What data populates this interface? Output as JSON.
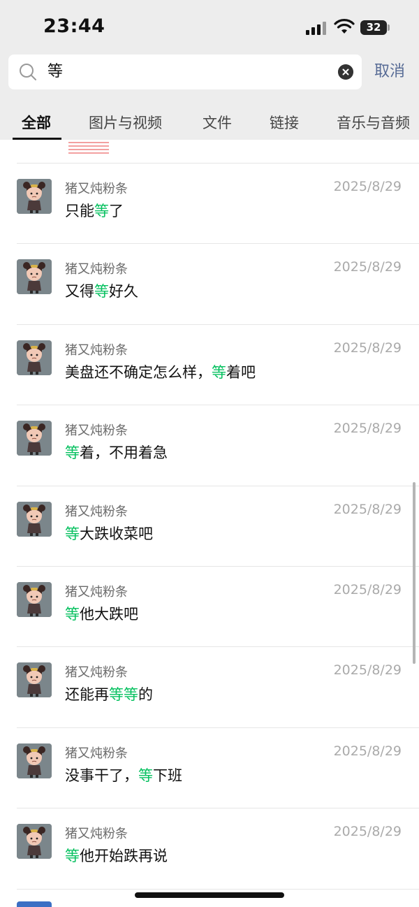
{
  "status_bar": {
    "time": "23:44",
    "battery": "32"
  },
  "search": {
    "value": "等",
    "cancel_label": "取消"
  },
  "tabs": [
    {
      "label": "全部",
      "active": true
    },
    {
      "label": "图片与视频",
      "active": false
    },
    {
      "label": "文件",
      "active": false
    },
    {
      "label": "链接",
      "active": false
    },
    {
      "label": "音乐与音频",
      "active": false
    }
  ],
  "results": [
    {
      "sender": "猪又炖粉条",
      "date": "2025/8/29",
      "parts": [
        "只能",
        "等",
        "了"
      ]
    },
    {
      "sender": "猪又炖粉条",
      "date": "2025/8/29",
      "parts": [
        "又得",
        "等",
        "好久"
      ]
    },
    {
      "sender": "猪又炖粉条",
      "date": "2025/8/29",
      "parts": [
        "美盘还不确定怎么样，",
        "等",
        "着吧"
      ]
    },
    {
      "sender": "猪又炖粉条",
      "date": "2025/8/29",
      "parts": [
        "",
        "等",
        "着，不用着急"
      ]
    },
    {
      "sender": "猪又炖粉条",
      "date": "2025/8/29",
      "parts": [
        "",
        "等",
        "大跌收菜吧"
      ]
    },
    {
      "sender": "猪又炖粉条",
      "date": "2025/8/29",
      "parts": [
        "",
        "等",
        "他大跌吧"
      ]
    },
    {
      "sender": "猪又炖粉条",
      "date": "2025/8/29",
      "parts": [
        "还能再",
        "等等",
        "的"
      ]
    },
    {
      "sender": "猪又炖粉条",
      "date": "2025/8/29",
      "parts": [
        "没事干了，",
        "等",
        "下班"
      ]
    },
    {
      "sender": "猪又炖粉条",
      "date": "2025/8/29",
      "parts": [
        "",
        "等",
        "他开始跌再说"
      ]
    }
  ],
  "colors": {
    "highlight": "#07c160",
    "cancel": "#576b95",
    "header_bg": "#ededed"
  }
}
